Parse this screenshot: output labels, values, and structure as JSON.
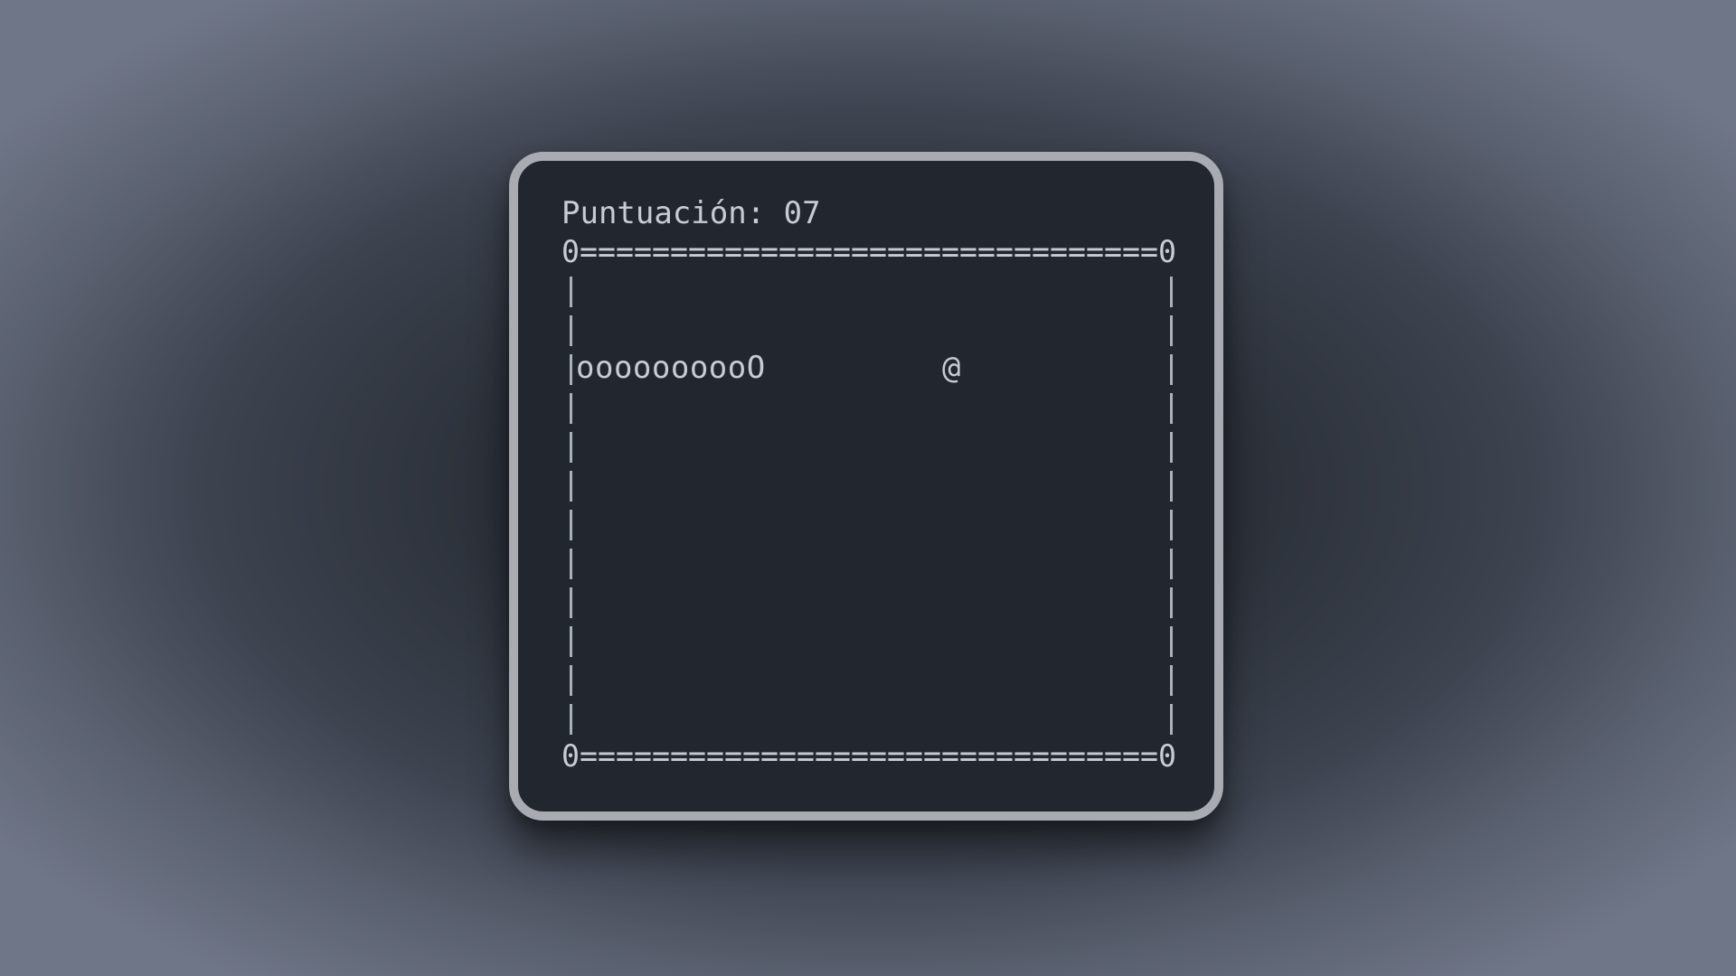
{
  "game": {
    "score_label": "Puntuación: 07",
    "corner_char": "0",
    "border_top": "0================================0",
    "border_bottom": "0================================0",
    "snake": "oooooooooO",
    "food": "@"
  },
  "colors": {
    "terminal_bg": "#22262e",
    "terminal_frame": "#a8acb2",
    "text": "#c8ccd2"
  }
}
